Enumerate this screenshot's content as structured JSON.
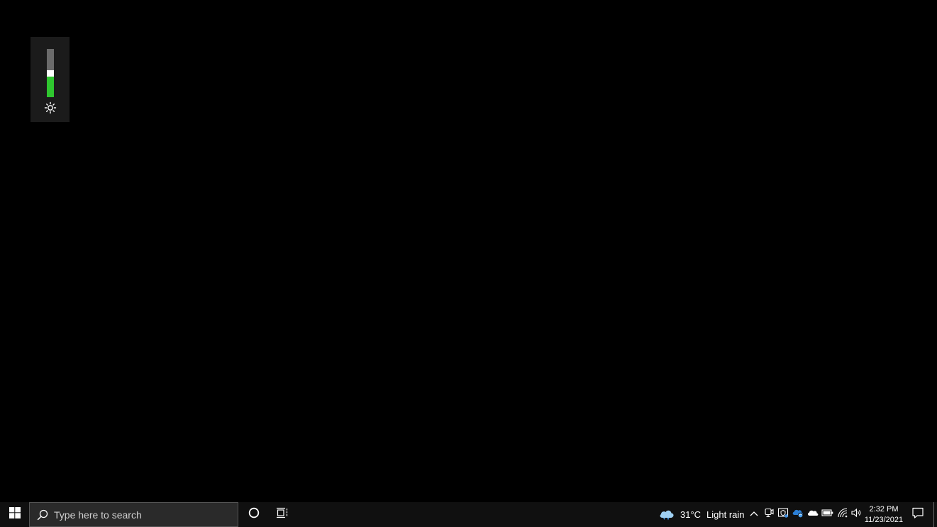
{
  "brightness": {
    "level_percent": 42,
    "icon": "sun-icon",
    "colors": {
      "panel": "#1b1b1b",
      "track": "#6b6b6b",
      "fill": "#2fc62f",
      "thumb": "#ffffff"
    }
  },
  "taskbar": {
    "background": "#101010",
    "start_icon": "windows-logo-icon",
    "search": {
      "placeholder": "Type here to search",
      "icon": "search-icon"
    },
    "cortana_icon": "cortana-circle-icon",
    "task_view_icon": "task-view-icon",
    "weather": {
      "icon": "rain-cloud-icon",
      "temperature": "31°C",
      "condition": "Light rain"
    },
    "tray_icons": [
      "chevron-up-icon",
      "meet-now-icon",
      "windows-security-icon",
      "onedrive-sync-icon",
      "onedrive-icon",
      "battery-icon",
      "wifi-icon",
      "speaker-icon"
    ],
    "clock": {
      "time": "2:32 PM",
      "date": "11/23/2021"
    },
    "notification_icon": "action-center-icon"
  }
}
